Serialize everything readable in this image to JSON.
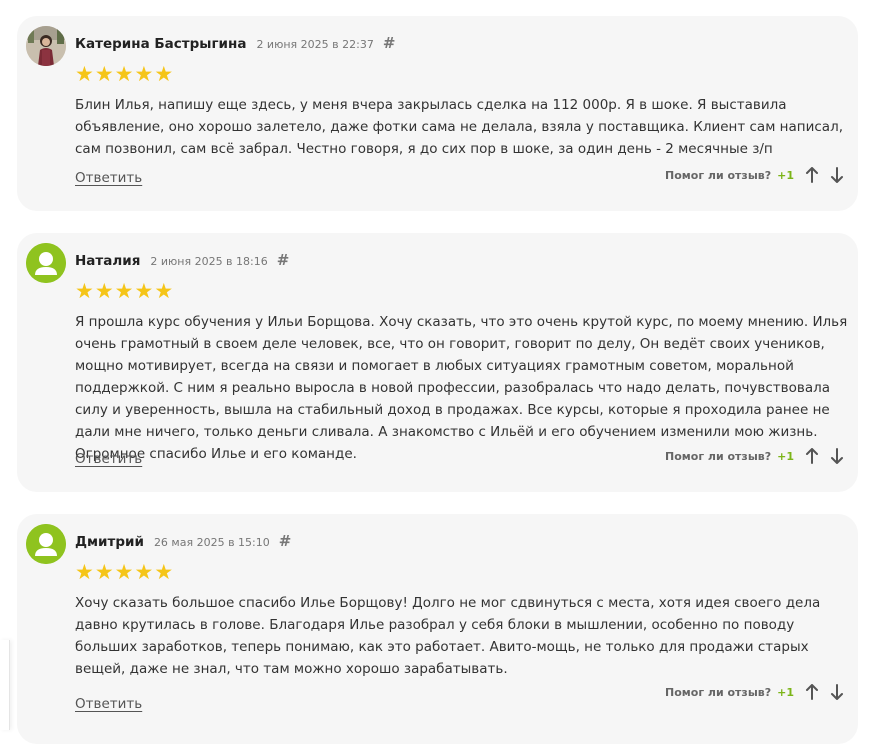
{
  "reviews": [
    {
      "author": "Катерина Бастрыгина",
      "date": "2 июня 2025 в 22:37",
      "hash": "#",
      "rating": 5,
      "text": "Блин Илья, напишу еще здесь, у меня вчера закрылась сделка на 112 000р. Я в шоке. Я выставила объявление, оно хорошо залетело, даже фотки сама не делала, взяла у поставщика. Клиент сам написал, сам позвонил, сам всё забрал. Честно говоря, я до сих пор в шоке, за один день - 2 месячные з/п",
      "reply": "Ответить",
      "helpful_label": "Помог ли отзыв?",
      "helpful_count": "+1",
      "avatar": "photo"
    },
    {
      "author": "Наталия",
      "date": "2 июня 2025 в 18:16",
      "hash": "#",
      "rating": 5,
      "text": "Я прошла курс обучения у Ильи Борщова. Хочу сказать, что это очень крутой курс, по моему мнению. Илья очень грамотный в своем деле человек, все, что он говорит, говорит по делу, Он ведёт своих учеников, мощно мотивирует, всегда на связи и помогает в любых ситуациях грамотным советом, моральной поддержкой. С ним я реально выросла в новой профессии, разобралась что надо делать, почувствовала силу и уверенность, вышла на стабильный доход в продажах. Все курсы, которые я проходила ранее не дали мне ничего, только деньги сливала. А знакомство с Ильёй и его обучением изменили мою жизнь. Огромное спасибо Илье и его команде.",
      "reply": "Ответить",
      "helpful_label": "Помог ли отзыв?",
      "helpful_count": "+1",
      "avatar": "default-user-icon"
    },
    {
      "author": "Дмитрий",
      "date": "26 мая 2025 в 15:10",
      "hash": "#",
      "rating": 5,
      "text": "Хочу сказать большое спасибо Илье Борщову! Долго не мог сдвинуться с места, хотя идея своего дела давно крутилась в голове. Благодаря Илье разобрал у себя блоки в мышлении, особенно по поводу больших заработков, теперь понимаю, как это работает. Авито-мощь, не только для продажи старых вещей, даже не знал, что там можно хорошо зарабатывать.",
      "reply": "Ответить",
      "helpful_label": "Помог ли отзыв?",
      "helpful_count": "+1",
      "avatar": "default-user-icon"
    }
  ],
  "icons": {
    "star": "★",
    "upvote": "arrow-up-icon",
    "downvote": "arrow-down-icon",
    "default_avatar": "user-silhouette-icon"
  },
  "colors": {
    "card_bg": "#f6f6f6",
    "star": "#f5c518",
    "helpful_count": "#7cb518",
    "default_avatar": "#8fc31f"
  }
}
